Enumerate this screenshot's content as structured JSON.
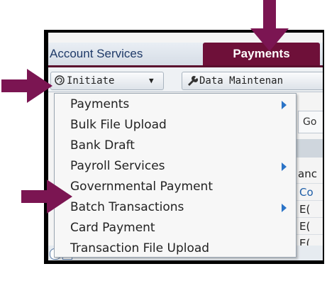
{
  "tabs": [
    {
      "label": "Account Services",
      "active": false
    },
    {
      "label": "Payments",
      "active": true
    }
  ],
  "toolbar": {
    "initiate_label": "Initiate",
    "data_label": "Data Maintenan"
  },
  "background": {
    "go_label": "Go",
    "and_label": "anc",
    "row_labels": [
      "Co",
      "E(",
      "E(",
      "E("
    ]
  },
  "menu": {
    "items": [
      {
        "label": "Payments",
        "has_submenu": true
      },
      {
        "label": "Bulk File Upload",
        "has_submenu": false
      },
      {
        "label": "Bank Draft",
        "has_submenu": false
      },
      {
        "label": "Payroll Services",
        "has_submenu": true
      },
      {
        "label": "Governmental Payment",
        "has_submenu": false
      },
      {
        "label": "Batch Transactions",
        "has_submenu": true
      },
      {
        "label": "Card Payment",
        "has_submenu": false
      },
      {
        "label": "Transaction File Upload",
        "has_submenu": false
      }
    ]
  },
  "colors": {
    "active_tab": "#6e1039",
    "tab_text": "#1f3a68",
    "callout_arrow": "#7b1552",
    "submenu_arrow": "#2b74c7"
  }
}
